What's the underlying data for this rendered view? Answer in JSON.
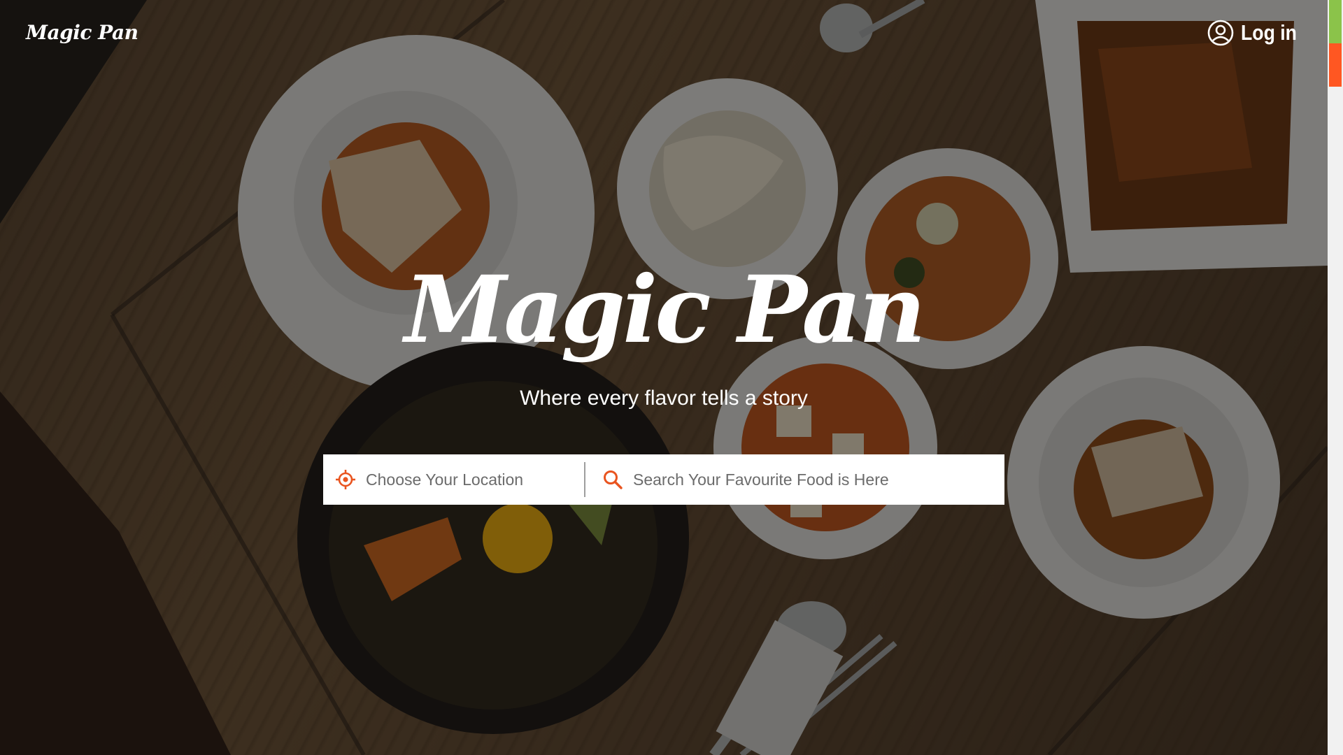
{
  "header": {
    "brand": "Magic Pan",
    "login_label": "Log in",
    "login_icon": "user-circle-icon"
  },
  "hero": {
    "title": "Magic Pan",
    "tagline": "Where every flavor tells a story"
  },
  "search": {
    "location": {
      "icon": "crosshair-location-icon",
      "placeholder": "Choose Your Location",
      "value": ""
    },
    "food": {
      "icon": "search-icon",
      "placeholder": "Search Your Favourite Food is Here",
      "value": ""
    }
  },
  "colors": {
    "accent": "#e9541f",
    "text_on_image": "#ffffff",
    "scroll_thumb_top": "#8bc34a",
    "scroll_thumb_bottom": "#ff5722"
  }
}
